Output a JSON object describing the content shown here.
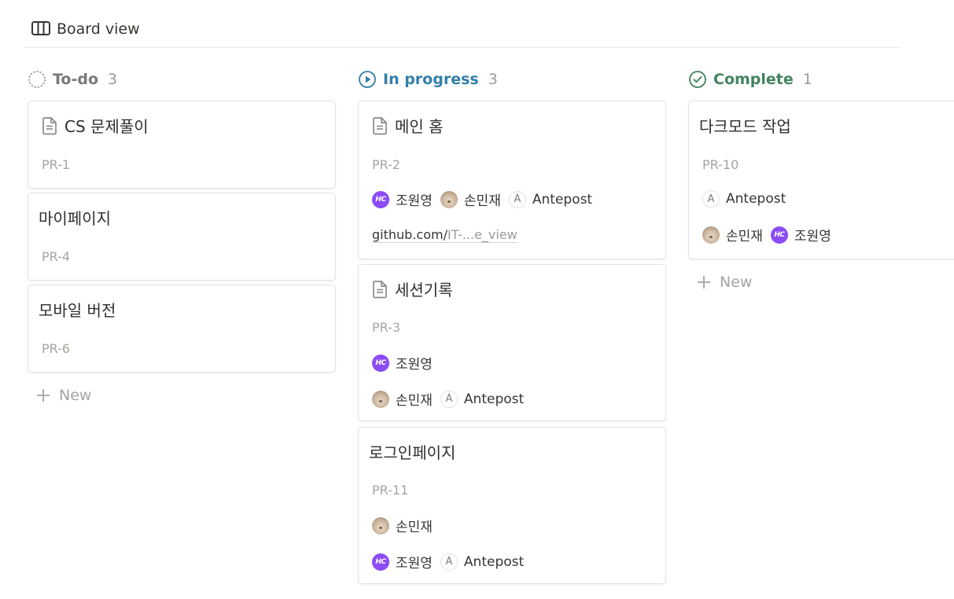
{
  "view": {
    "label": "Board view",
    "icon": "board-icon"
  },
  "columns": [
    {
      "title": "To-do",
      "count": "3",
      "color": "#787774",
      "icon": "todo-circle-icon",
      "new_label": "New",
      "cards": [
        {
          "title": "CS 문제풀이",
          "id": "PR-1",
          "has_doc_icon": true
        },
        {
          "title": "마이페이지",
          "id": "PR-4"
        },
        {
          "title": "모바일 버전",
          "id": "PR-6"
        }
      ]
    },
    {
      "title": "In progress",
      "count": "3",
      "color": "#337ea9",
      "icon": "in-progress-icon",
      "cards": [
        {
          "title": "메인 홈",
          "id": "PR-2",
          "has_doc_icon": true,
          "people": [
            "조원영",
            "손민재",
            "Antepost"
          ],
          "link": {
            "host": "github.com/",
            "path": "IT-...e_view"
          }
        },
        {
          "title": "세션기록",
          "id": "PR-3",
          "has_doc_icon": true,
          "people_row1": [
            "조원영"
          ],
          "people_row2": [
            "손민재",
            "Antepost"
          ]
        },
        {
          "title": "로그인페이지",
          "id": "PR-11",
          "people_row1": [
            "손민재"
          ],
          "people_row2": [
            "조원영",
            "Antepost"
          ]
        }
      ]
    },
    {
      "title": "Complete",
      "count": "1",
      "color": "#448361",
      "icon": "complete-check-icon",
      "new_label": "New",
      "cards": [
        {
          "title": "다크모드 작업",
          "id": "PR-10",
          "people_row1": [
            "Antepost"
          ],
          "people_row2": [
            "손민재",
            "조원영"
          ]
        }
      ]
    }
  ],
  "avatar_text": {
    "purple": "HC",
    "letter": "A"
  }
}
